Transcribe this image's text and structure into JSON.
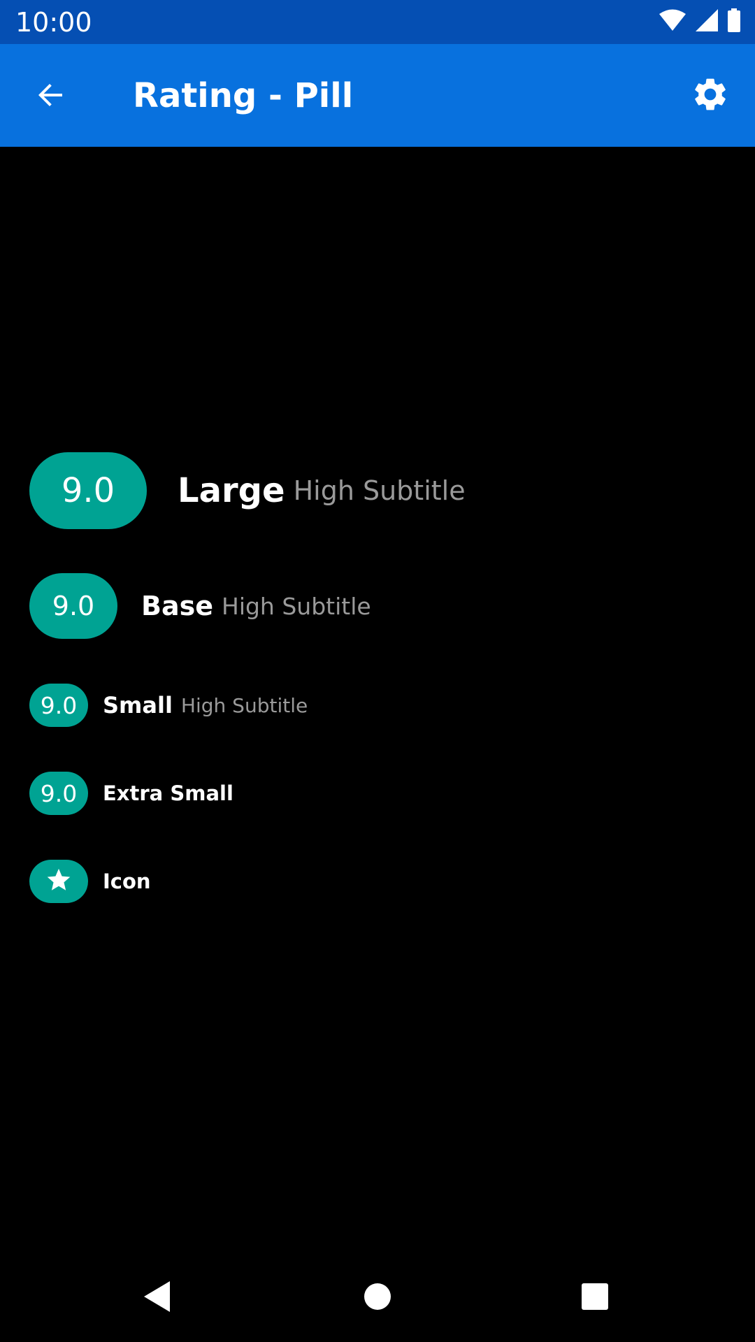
{
  "status_bar": {
    "time": "10:00",
    "icons": [
      "wifi-icon",
      "signal-icon",
      "battery-icon"
    ],
    "background": "#054fb3"
  },
  "app_bar": {
    "title": "Rating - Pill",
    "background": "#0871de",
    "back_icon": "arrow-back-icon",
    "settings_icon": "gear-icon"
  },
  "ratings": {
    "pill_color": "#00a393",
    "large": {
      "value": "9.0",
      "label": "Large",
      "subtitle": "High Subtitle"
    },
    "base": {
      "value": "9.0",
      "label": "Base",
      "subtitle": "High Subtitle"
    },
    "small": {
      "value": "9.0",
      "label": "Small",
      "subtitle": "High Subtitle"
    },
    "extra_small": {
      "value": "9.0",
      "label": "Extra Small"
    },
    "icon": {
      "icon": "star-icon",
      "label": "Icon"
    }
  },
  "nav_bar": {
    "buttons": [
      "back-triangle-icon",
      "home-circle-icon",
      "recents-square-icon"
    ]
  }
}
